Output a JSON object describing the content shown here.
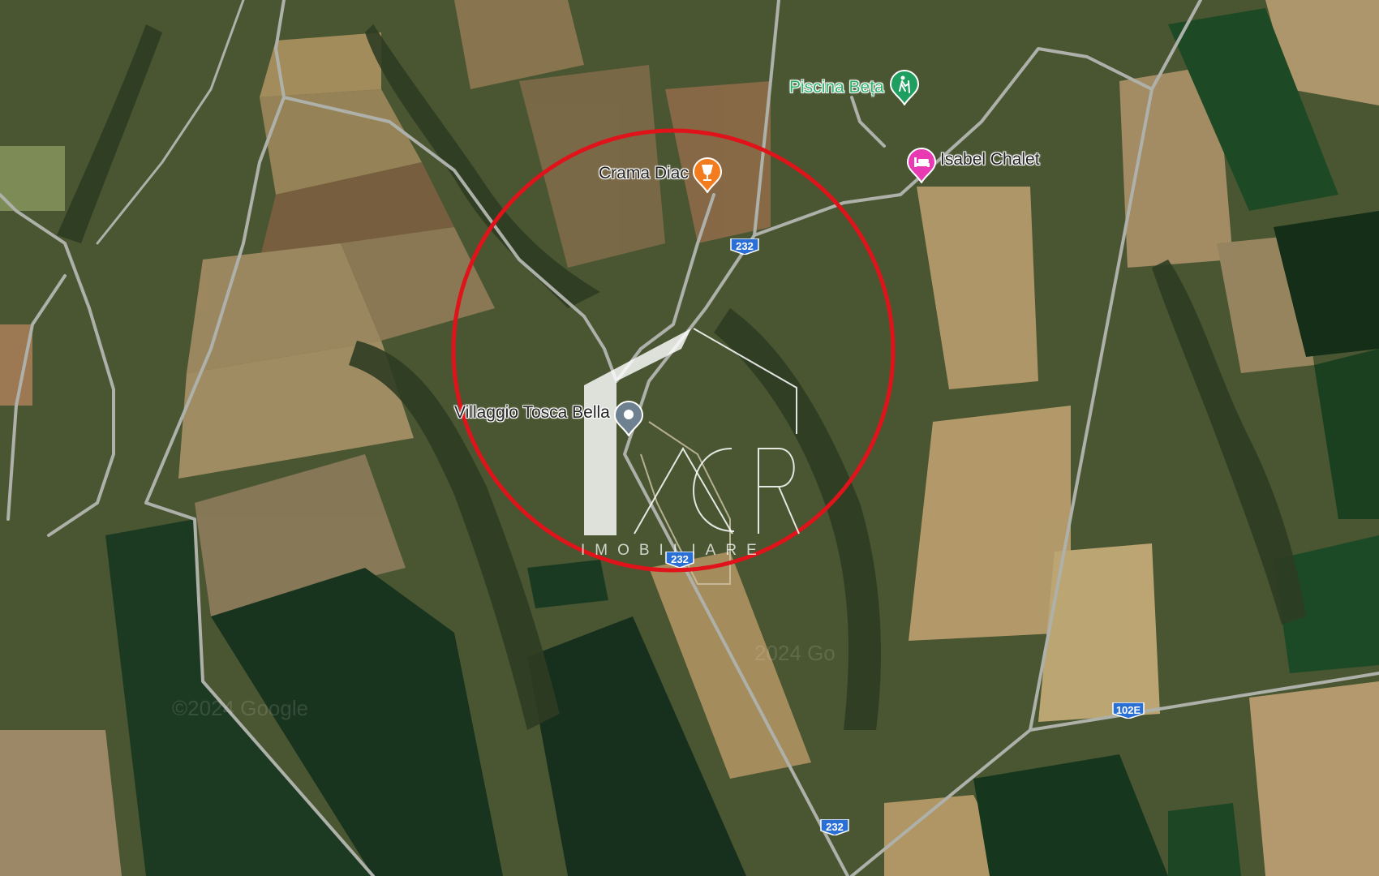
{
  "map": {
    "type": "satellite",
    "accent_circle_color": "#e0131a",
    "pois": [
      {
        "id": "piscina",
        "label": "Piscina Beța",
        "icon": "hiking-icon",
        "color": "#1e9e5f",
        "label_color": "#2fb06a"
      },
      {
        "id": "crama",
        "label": "Crama Diac",
        "icon": "wine-glass-icon",
        "color": "#f37c1f",
        "label_color": "#222222"
      },
      {
        "id": "isabel",
        "label": "Isabel Chalet",
        "icon": "bed-icon",
        "color": "#e83ab3",
        "label_color": "#222222"
      },
      {
        "id": "villaggio",
        "label": "Villaggio Tosca Bella",
        "icon": "location-pin-icon",
        "color": "#6d8190",
        "label_color": "#222222"
      }
    ],
    "road_shields": [
      {
        "id": "r232-top",
        "label": "232"
      },
      {
        "id": "r232-mid",
        "label": "232"
      },
      {
        "id": "r232-bottom",
        "label": "232"
      },
      {
        "id": "r102e",
        "label": "102E"
      }
    ],
    "watermark": {
      "letters": "AGR",
      "subtitle": "IMOBILIARE"
    },
    "copyright": [
      "©2024 Google",
      "2024 Go"
    ]
  }
}
